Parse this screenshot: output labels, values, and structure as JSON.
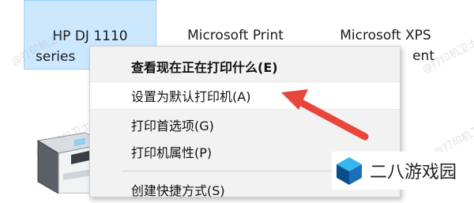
{
  "printers": [
    {
      "line1": "HP DJ 1110",
      "line2": "series"
    },
    {
      "line1": "Microsoft Print",
      "line2": ""
    },
    {
      "line1": "Microsoft XPS",
      "line2": "ent"
    }
  ],
  "watermark_text": "@打印机卫士",
  "context_menu": {
    "items": [
      {
        "label": "查看现在正在打印什么(E)"
      },
      {
        "label": "设置为默认打印机(A)"
      },
      {
        "label": "打印首选项(G)"
      },
      {
        "label": "打印机属性(P)"
      },
      {
        "label": "创建快捷方式(S)"
      }
    ]
  },
  "brand": {
    "name": "二八游戏园"
  },
  "colors": {
    "selection": "#cce8ff",
    "arrow": "#e8463a",
    "logo_dark": "#0a4d8c",
    "logo_light": "#36b6f0"
  },
  "icons": {
    "printer": "printer-icon",
    "arrow": "red-arrow-annotation",
    "brand": "brand-cube-logo"
  }
}
